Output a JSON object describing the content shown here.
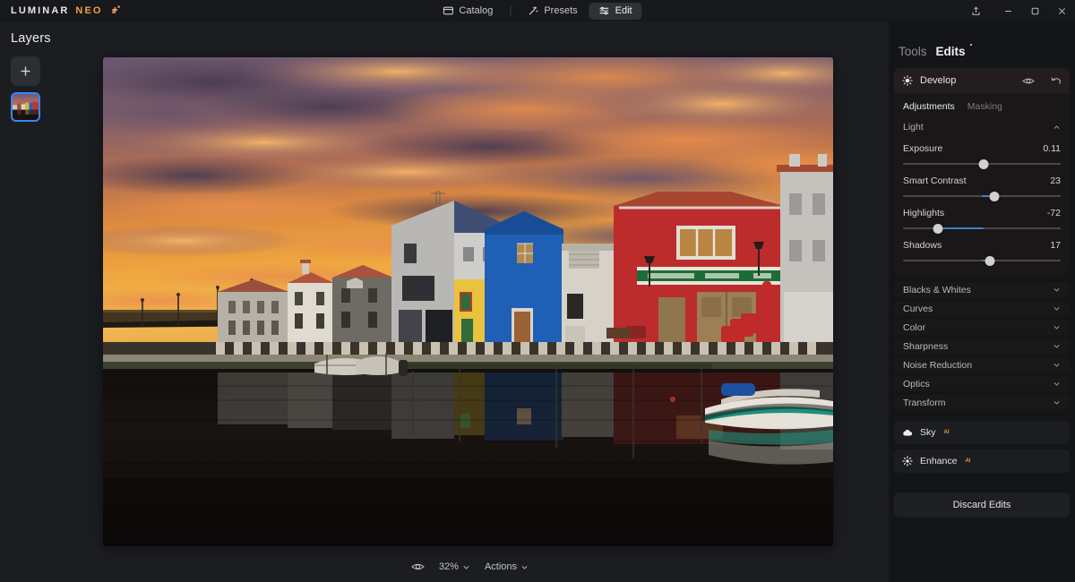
{
  "titlebar": {
    "brand_primary": "LUMINAR",
    "brand_secondary": "NEO",
    "brand_mark_icon": "luminar-leaf-icon",
    "nav": [
      {
        "label": "Catalog",
        "icon": "catalog-icon",
        "active": false
      },
      {
        "label": "Presets",
        "icon": "presets-icon",
        "active": false
      },
      {
        "label": "Edit",
        "icon": "edit-sliders-icon",
        "active": true
      }
    ],
    "window_controls": [
      {
        "name": "share-icon",
        "glyph": "share"
      },
      {
        "name": "minimize-icon",
        "glyph": "minimize"
      },
      {
        "name": "maximize-icon",
        "glyph": "maximize"
      },
      {
        "name": "close-icon",
        "glyph": "close"
      }
    ]
  },
  "left_panel": {
    "title": "Layers",
    "add_layer_icon": "plus-icon",
    "layer_thumbnail_label": "layer-thumbnail"
  },
  "canvas": {
    "image_alt": "Colorful canal houses at sunset with water reflection",
    "bottom_bar": {
      "preview_icon": "eye-icon",
      "zoom_value": "32%",
      "zoom_chevron": "chevron-down-icon",
      "actions_label": "Actions",
      "actions_chevron": "chevron-down-icon"
    }
  },
  "right_panel": {
    "tabs": [
      {
        "label": "Tools",
        "active": false,
        "dot": false
      },
      {
        "label": "Edits",
        "active": true,
        "dot": true
      }
    ],
    "tool": {
      "icon": "develop-sun-icon",
      "title": "Develop",
      "visibility_icon": "eye-icon",
      "reset_icon": "undo-icon",
      "subtabs": [
        {
          "label": "Adjustments",
          "active": true
        },
        {
          "label": "Masking",
          "active": false
        }
      ],
      "light_section": {
        "title": "Light",
        "chevron": "chevron-up-icon",
        "sliders": [
          {
            "label": "Exposure",
            "value": "0.11",
            "thumb_pct": 51,
            "fill_from_pct": 51,
            "fill_to_pct": 51
          },
          {
            "label": "Smart Contrast",
            "value": "23",
            "thumb_pct": 58,
            "fill_from_pct": 50,
            "fill_to_pct": 58
          },
          {
            "label": "Highlights",
            "value": "-72",
            "thumb_pct": 22,
            "fill_from_pct": 22,
            "fill_to_pct": 51
          },
          {
            "label": "Shadows",
            "value": "17",
            "thumb_pct": 55,
            "fill_from_pct": 50,
            "fill_to_pct": 55
          }
        ]
      },
      "collapsed_sections": [
        {
          "label": "Blacks & Whites",
          "chevron": "chevron-down-icon"
        },
        {
          "label": "Curves",
          "chevron": "chevron-down-icon"
        },
        {
          "label": "Color",
          "chevron": "chevron-down-icon"
        },
        {
          "label": "Sharpness",
          "chevron": "chevron-down-icon"
        },
        {
          "label": "Noise Reduction",
          "chevron": "chevron-down-icon"
        },
        {
          "label": "Optics",
          "chevron": "chevron-down-icon"
        },
        {
          "label": "Transform",
          "chevron": "chevron-down-icon"
        }
      ]
    },
    "ai_tools": [
      {
        "label": "Sky",
        "badge": "AI",
        "icon": "cloud-icon"
      },
      {
        "label": "Enhance",
        "badge": "AI",
        "icon": "sparkle-icon"
      }
    ],
    "discard_label": "Discard Edits"
  },
  "colors": {
    "accent_orange": "#f0a046",
    "selection_blue": "#3a86f7",
    "slider_fill_blue": "#3f7fd0",
    "panel_bg": "#141518",
    "tool_card_bg": "#1a1718",
    "app_bg": "#1b1d21"
  }
}
